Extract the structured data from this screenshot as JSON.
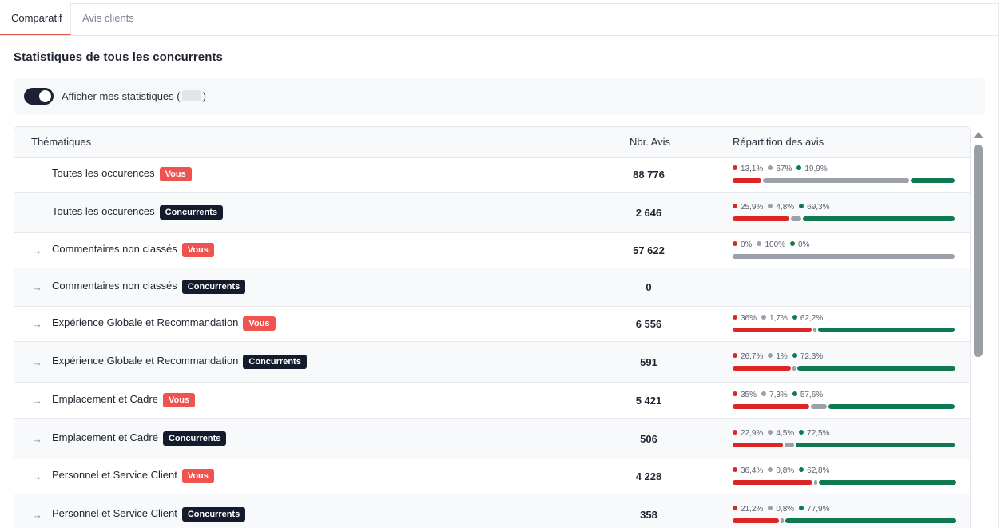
{
  "tabs": [
    {
      "label": "Comparatif",
      "active": true
    },
    {
      "label": "Avis clients",
      "active": false
    }
  ],
  "section_title": "Statistiques de tous les concurrents",
  "toggle": {
    "label": "Afficher mes statistiques (",
    "label_end": ")",
    "on": true
  },
  "table": {
    "headers": {
      "theme": "Thématiques",
      "count": "Nbr. Avis",
      "dist": "Répartition des avis"
    },
    "rows": [
      {
        "name": "Toutes les occurences",
        "badge": "Vous",
        "badge_type": "vous",
        "count": "88 776",
        "expandable": false,
        "neg": "13,1%",
        "neu": "67%",
        "pos": "19,9%",
        "neg_v": 13.1,
        "neu_v": 67,
        "pos_v": 19.9,
        "has_dist": true
      },
      {
        "name": "Toutes les occurences",
        "badge": "Concurrents",
        "badge_type": "conc",
        "count": "2 646",
        "expandable": false,
        "neg": "25,9%",
        "neu": "4,8%",
        "pos": "69,3%",
        "neg_v": 25.9,
        "neu_v": 4.8,
        "pos_v": 69.3,
        "has_dist": true
      },
      {
        "name": "Commentaires non classés",
        "badge": "Vous",
        "badge_type": "vous",
        "count": "57 622",
        "expandable": true,
        "neg": "0%",
        "neu": "100%",
        "pos": "0%",
        "neg_v": 0,
        "neu_v": 100,
        "pos_v": 0,
        "has_dist": true
      },
      {
        "name": "Commentaires non classés",
        "badge": "Concurrents",
        "badge_type": "conc",
        "count": "0",
        "expandable": true,
        "has_dist": false
      },
      {
        "name": "Expérience Globale et Recommandation",
        "badge": "Vous",
        "badge_type": "vous",
        "count": "6 556",
        "expandable": true,
        "neg": "36%",
        "neu": "1,7%",
        "pos": "62,2%",
        "neg_v": 36,
        "neu_v": 1.7,
        "pos_v": 62.2,
        "has_dist": true
      },
      {
        "name": "Expérience Globale et Recommandation",
        "badge": "Concurrents",
        "badge_type": "conc",
        "count": "591",
        "expandable": true,
        "neg": "26,7%",
        "neu": "1%",
        "pos": "72,3%",
        "neg_v": 26.7,
        "neu_v": 1,
        "pos_v": 72.3,
        "has_dist": true
      },
      {
        "name": "Emplacement et Cadre",
        "badge": "Vous",
        "badge_type": "vous",
        "count": "5 421",
        "expandable": true,
        "neg": "35%",
        "neu": "7,3%",
        "pos": "57,6%",
        "neg_v": 35,
        "neu_v": 7.3,
        "pos_v": 57.6,
        "has_dist": true
      },
      {
        "name": "Emplacement et Cadre",
        "badge": "Concurrents",
        "badge_type": "conc",
        "count": "506",
        "expandable": true,
        "neg": "22,9%",
        "neu": "4,5%",
        "pos": "72,5%",
        "neg_v": 22.9,
        "neu_v": 4.5,
        "pos_v": 72.5,
        "has_dist": true
      },
      {
        "name": "Personnel et Service Client",
        "badge": "Vous",
        "badge_type": "vous",
        "count": "4 228",
        "expandable": true,
        "neg": "36,4%",
        "neu": "0,8%",
        "pos": "62,8%",
        "neg_v": 36.4,
        "neu_v": 0.8,
        "pos_v": 62.8,
        "has_dist": true
      },
      {
        "name": "Personnel et Service Client",
        "badge": "Concurrents",
        "badge_type": "conc",
        "count": "358",
        "expandable": true,
        "neg": "21,2%",
        "neu": "0,8%",
        "pos": "77,9%",
        "neg_v": 21.2,
        "neu_v": 0.8,
        "pos_v": 77.9,
        "has_dist": true
      }
    ]
  },
  "colors": {
    "negative": "#dc2626",
    "neutral": "#9ca0a8",
    "positive": "#0f7a4f",
    "accent": "#e45a4a",
    "badge_vous": "#ef5350",
    "badge_conc": "#141b2d"
  }
}
